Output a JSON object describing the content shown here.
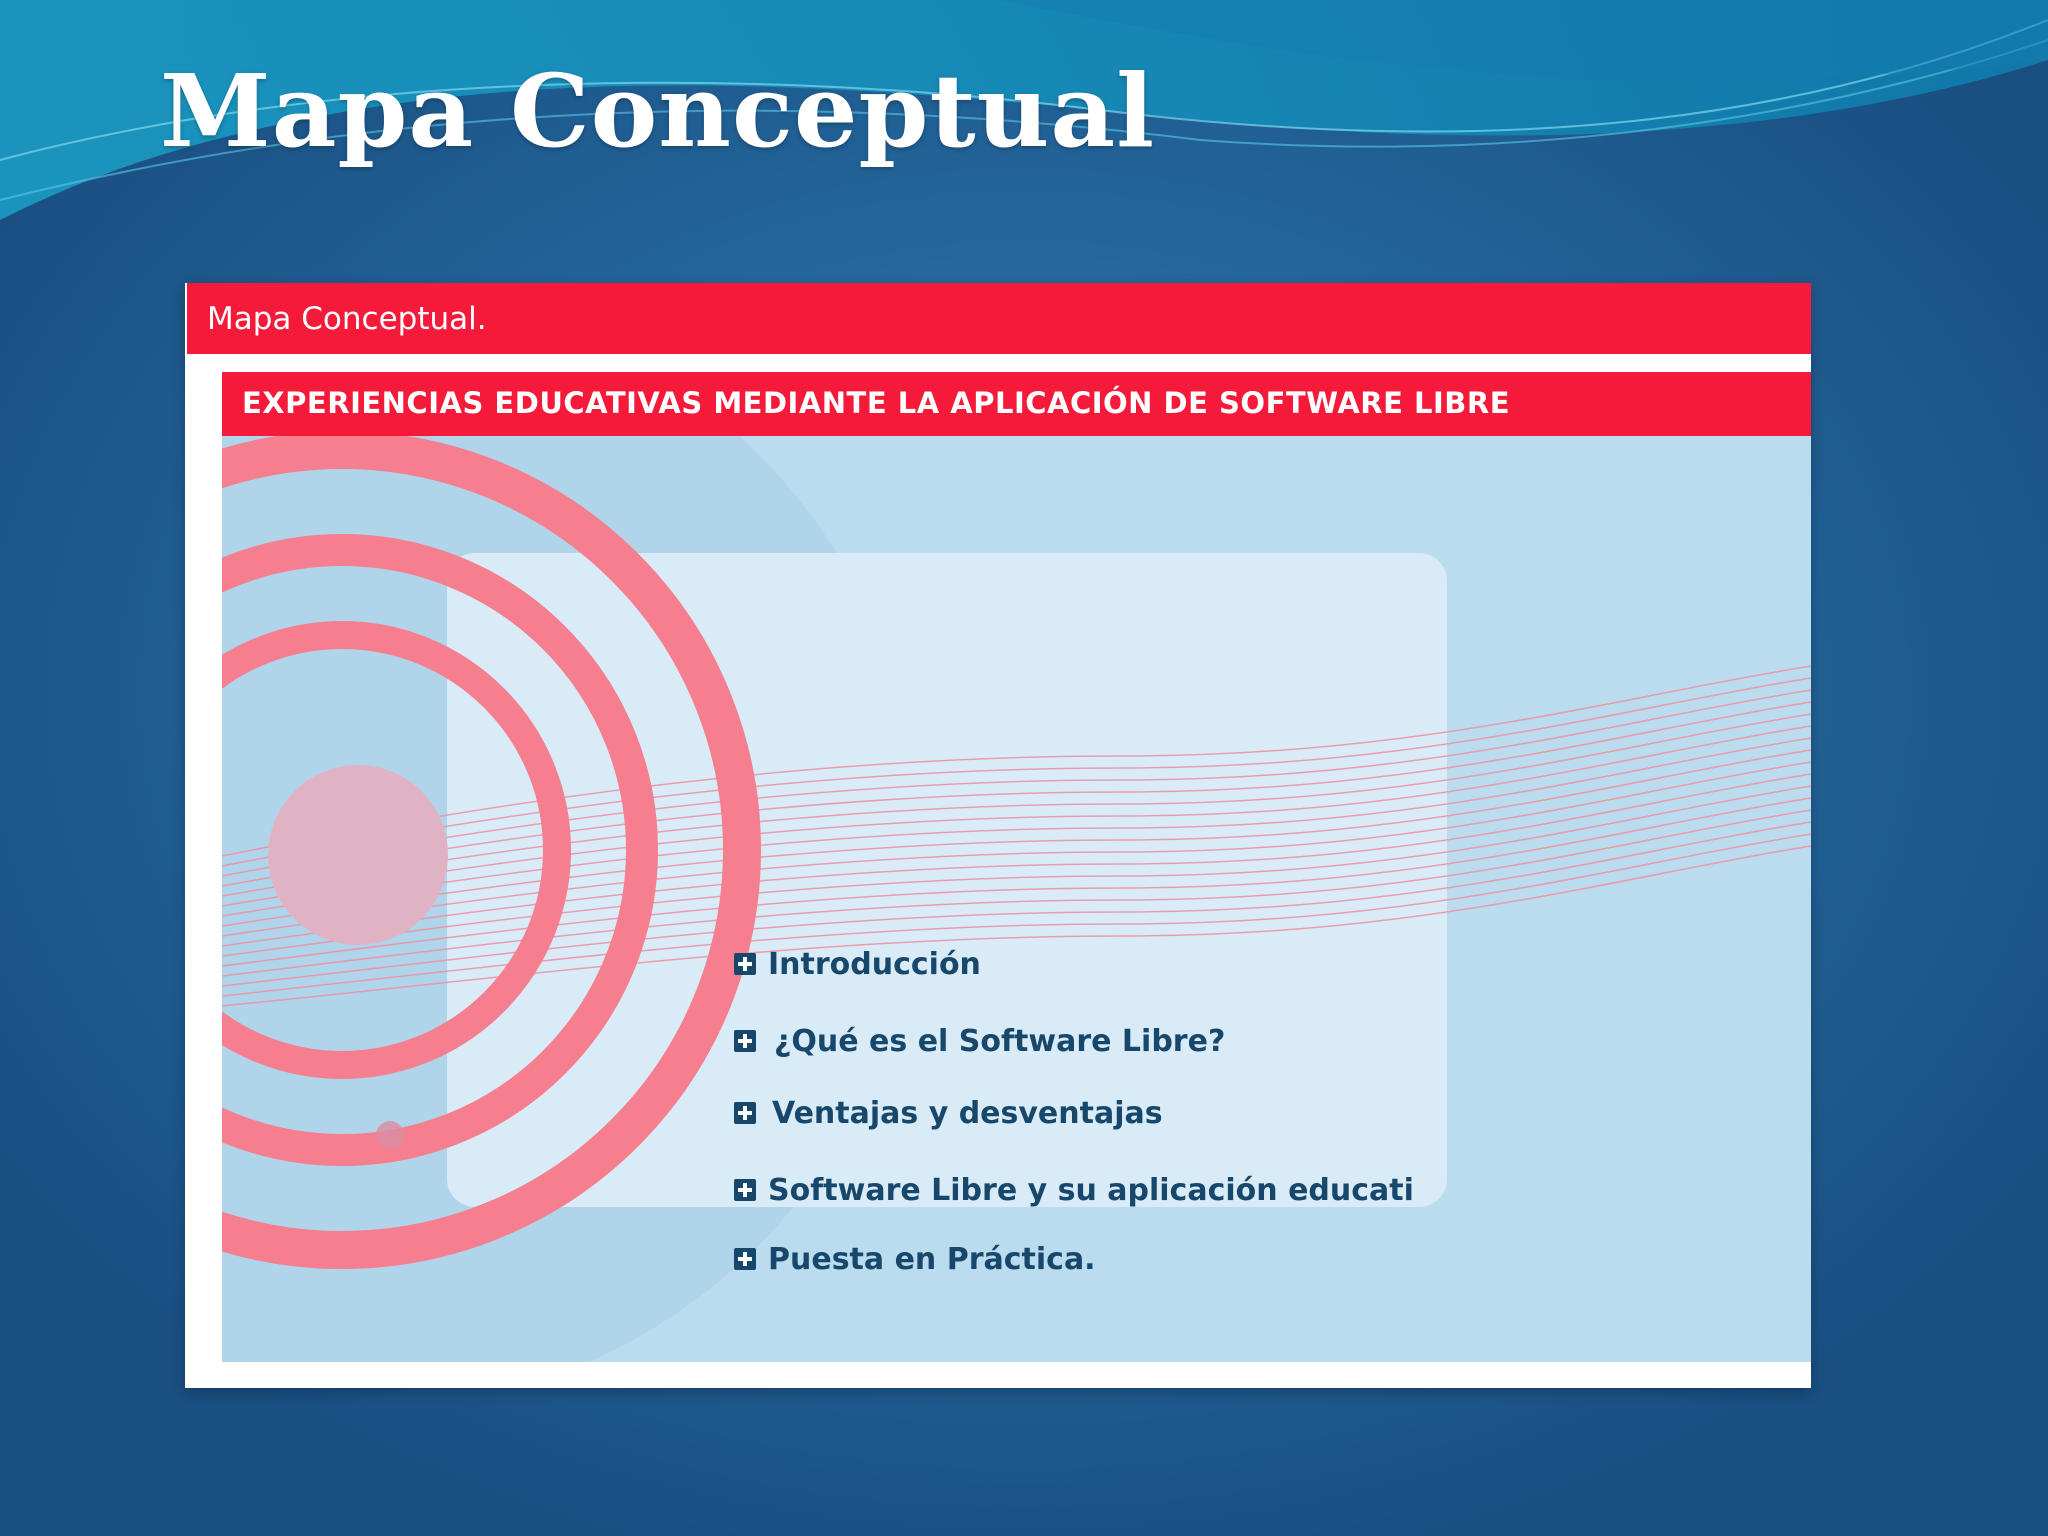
{
  "slide": {
    "title": "Mapa Conceptual"
  },
  "window": {
    "title": "Mapa Conceptual."
  },
  "banner": {
    "title": "EXPERIENCIAS EDUCATIVAS MEDIANTE LA APLICACIÓN DE SOFTWARE LIBRE"
  },
  "menu": {
    "items": [
      {
        "label": "Introducción",
        "icon": "plus-square-icon"
      },
      {
        "label": "¿Qué es el Software Libre?",
        "icon": "plus-square-icon"
      },
      {
        "label": "Ventajas y desventajas",
        "icon": "plus-square-icon"
      },
      {
        "label": "Software Libre y su aplicación educativa",
        "icon": "plus-square-icon"
      },
      {
        "label": "Puesta en Práctica.",
        "icon": "plus-square-icon"
      }
    ]
  },
  "colors": {
    "accent_red": "#f5193a",
    "content_bg": "#bbdbef",
    "panel_bg": "#d9ebf7",
    "ring_pink": "#f57f8f",
    "menu_text": "#17476b",
    "slide_bg": "#25699e"
  }
}
